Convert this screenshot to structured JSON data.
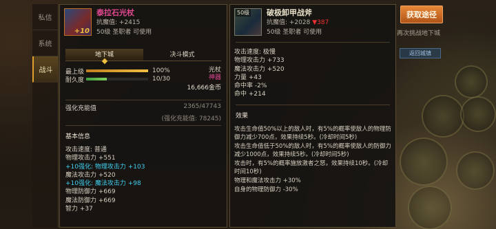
{
  "sidebar": {
    "tabs": [
      {
        "label": "私信",
        "active": false
      },
      {
        "label": "系统",
        "active": false
      },
      {
        "label": "战斗",
        "active": true
      }
    ]
  },
  "left_item": {
    "level_badge": "",
    "upgrade": "+10",
    "name": "泰拉石光杖",
    "resist": "抗魔值: +2415",
    "req": "50级 圣职者 可使用",
    "modes": [
      "地下城",
      "决斗模式"
    ],
    "grade_label": "最上级",
    "grade_value": "100%",
    "grade_fill": 1.0,
    "durability_label": "耐久度",
    "durability_value": "10/30",
    "durability_fill": 0.33,
    "weapon_type": "光杖",
    "weapon_tag": "神器",
    "price": "16,666金币",
    "reinforce_label": "强化充能值",
    "reinforce_value": "2365/47743",
    "reinforce_sub": "(强化充能值: 78245)",
    "basic_title": "基本信息",
    "lines": [
      {
        "text": "攻击速度: 普通",
        "color": "white"
      },
      {
        "text": "物理攻击力 +551",
        "color": "white"
      },
      {
        "text": "+10强化: 物理攻击力 +103",
        "color": "cyan"
      },
      {
        "text": "魔法攻击力 +520",
        "color": "white"
      },
      {
        "text": "+10强化: 魔法攻击力 +98",
        "color": "cyan"
      },
      {
        "text": "物理防御力 +669",
        "color": "white"
      },
      {
        "text": "魔法防御力 +669",
        "color": "white"
      },
      {
        "text": "智力 +37",
        "color": "white"
      }
    ]
  },
  "right_item": {
    "level_badge": "50级",
    "name": "破极卸甲战斧",
    "resist": "抗魔值: +2028",
    "resist_drop": "▼387",
    "req": "50级 圣职者 可使用",
    "lines": [
      "攻击速度: 极慢",
      "物理攻击力 +733",
      "魔法攻击力 +520",
      "力量 +43",
      "命中率 -2%",
      "命中 +214"
    ],
    "effect_title": "效果",
    "effects": [
      "攻击生命值50%以上的敌人时，有5%的概率使敌人的物理防御力减少700点，效果持续5秒。(冷却时间5秒)",
      "攻击生命值低于50%的敌人时，有5%的概率使敌人的防御力减少1000点，效果持续5秒。(冷却时间5秒)",
      "攻击时，有5%的概率施放激者之怒，效果持续10秒。(冷却时间10秒)",
      "物理和魔法攻击力 +30%",
      "自身的物理防御力 -30%"
    ]
  },
  "overlay": {
    "get_button": "获取途径",
    "hint": "再次挑战地下城",
    "back_button": "返回城镇"
  }
}
